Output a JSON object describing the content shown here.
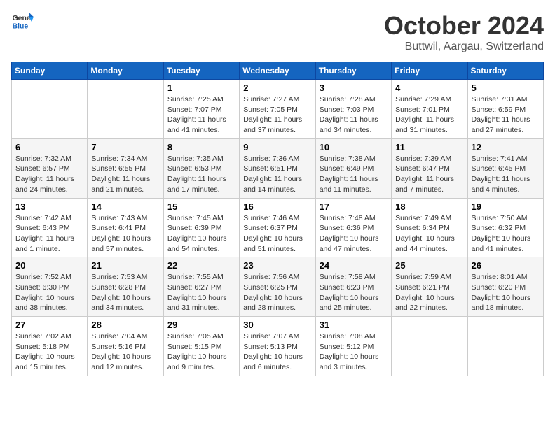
{
  "header": {
    "logo_general": "General",
    "logo_blue": "Blue",
    "month": "October 2024",
    "location": "Buttwil, Aargau, Switzerland"
  },
  "days_of_week": [
    "Sunday",
    "Monday",
    "Tuesday",
    "Wednesday",
    "Thursday",
    "Friday",
    "Saturday"
  ],
  "weeks": [
    [
      {
        "day": "",
        "info": ""
      },
      {
        "day": "",
        "info": ""
      },
      {
        "day": "1",
        "info": "Sunrise: 7:25 AM\nSunset: 7:07 PM\nDaylight: 11 hours and 41 minutes."
      },
      {
        "day": "2",
        "info": "Sunrise: 7:27 AM\nSunset: 7:05 PM\nDaylight: 11 hours and 37 minutes."
      },
      {
        "day": "3",
        "info": "Sunrise: 7:28 AM\nSunset: 7:03 PM\nDaylight: 11 hours and 34 minutes."
      },
      {
        "day": "4",
        "info": "Sunrise: 7:29 AM\nSunset: 7:01 PM\nDaylight: 11 hours and 31 minutes."
      },
      {
        "day": "5",
        "info": "Sunrise: 7:31 AM\nSunset: 6:59 PM\nDaylight: 11 hours and 27 minutes."
      }
    ],
    [
      {
        "day": "6",
        "info": "Sunrise: 7:32 AM\nSunset: 6:57 PM\nDaylight: 11 hours and 24 minutes."
      },
      {
        "day": "7",
        "info": "Sunrise: 7:34 AM\nSunset: 6:55 PM\nDaylight: 11 hours and 21 minutes."
      },
      {
        "day": "8",
        "info": "Sunrise: 7:35 AM\nSunset: 6:53 PM\nDaylight: 11 hours and 17 minutes."
      },
      {
        "day": "9",
        "info": "Sunrise: 7:36 AM\nSunset: 6:51 PM\nDaylight: 11 hours and 14 minutes."
      },
      {
        "day": "10",
        "info": "Sunrise: 7:38 AM\nSunset: 6:49 PM\nDaylight: 11 hours and 11 minutes."
      },
      {
        "day": "11",
        "info": "Sunrise: 7:39 AM\nSunset: 6:47 PM\nDaylight: 11 hours and 7 minutes."
      },
      {
        "day": "12",
        "info": "Sunrise: 7:41 AM\nSunset: 6:45 PM\nDaylight: 11 hours and 4 minutes."
      }
    ],
    [
      {
        "day": "13",
        "info": "Sunrise: 7:42 AM\nSunset: 6:43 PM\nDaylight: 11 hours and 1 minute."
      },
      {
        "day": "14",
        "info": "Sunrise: 7:43 AM\nSunset: 6:41 PM\nDaylight: 10 hours and 57 minutes."
      },
      {
        "day": "15",
        "info": "Sunrise: 7:45 AM\nSunset: 6:39 PM\nDaylight: 10 hours and 54 minutes."
      },
      {
        "day": "16",
        "info": "Sunrise: 7:46 AM\nSunset: 6:37 PM\nDaylight: 10 hours and 51 minutes."
      },
      {
        "day": "17",
        "info": "Sunrise: 7:48 AM\nSunset: 6:36 PM\nDaylight: 10 hours and 47 minutes."
      },
      {
        "day": "18",
        "info": "Sunrise: 7:49 AM\nSunset: 6:34 PM\nDaylight: 10 hours and 44 minutes."
      },
      {
        "day": "19",
        "info": "Sunrise: 7:50 AM\nSunset: 6:32 PM\nDaylight: 10 hours and 41 minutes."
      }
    ],
    [
      {
        "day": "20",
        "info": "Sunrise: 7:52 AM\nSunset: 6:30 PM\nDaylight: 10 hours and 38 minutes."
      },
      {
        "day": "21",
        "info": "Sunrise: 7:53 AM\nSunset: 6:28 PM\nDaylight: 10 hours and 34 minutes."
      },
      {
        "day": "22",
        "info": "Sunrise: 7:55 AM\nSunset: 6:27 PM\nDaylight: 10 hours and 31 minutes."
      },
      {
        "day": "23",
        "info": "Sunrise: 7:56 AM\nSunset: 6:25 PM\nDaylight: 10 hours and 28 minutes."
      },
      {
        "day": "24",
        "info": "Sunrise: 7:58 AM\nSunset: 6:23 PM\nDaylight: 10 hours and 25 minutes."
      },
      {
        "day": "25",
        "info": "Sunrise: 7:59 AM\nSunset: 6:21 PM\nDaylight: 10 hours and 22 minutes."
      },
      {
        "day": "26",
        "info": "Sunrise: 8:01 AM\nSunset: 6:20 PM\nDaylight: 10 hours and 18 minutes."
      }
    ],
    [
      {
        "day": "27",
        "info": "Sunrise: 7:02 AM\nSunset: 5:18 PM\nDaylight: 10 hours and 15 minutes."
      },
      {
        "day": "28",
        "info": "Sunrise: 7:04 AM\nSunset: 5:16 PM\nDaylight: 10 hours and 12 minutes."
      },
      {
        "day": "29",
        "info": "Sunrise: 7:05 AM\nSunset: 5:15 PM\nDaylight: 10 hours and 9 minutes."
      },
      {
        "day": "30",
        "info": "Sunrise: 7:07 AM\nSunset: 5:13 PM\nDaylight: 10 hours and 6 minutes."
      },
      {
        "day": "31",
        "info": "Sunrise: 7:08 AM\nSunset: 5:12 PM\nDaylight: 10 hours and 3 minutes."
      },
      {
        "day": "",
        "info": ""
      },
      {
        "day": "",
        "info": ""
      }
    ]
  ]
}
